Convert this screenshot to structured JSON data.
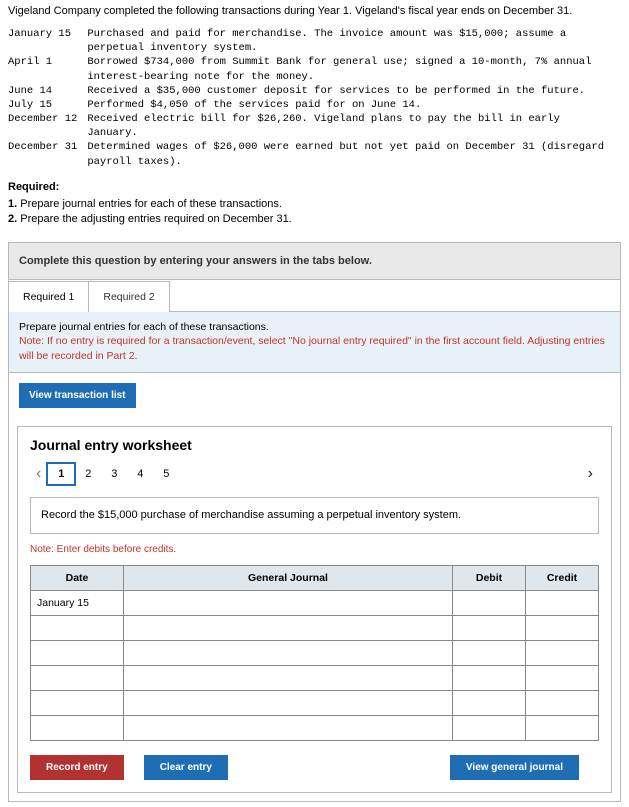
{
  "intro": "Vigeland Company completed the following transactions during Year 1. Vigeland's fiscal year ends on December 31.",
  "transactions": [
    {
      "date": "January 15",
      "desc": "Purchased and paid for merchandise. The invoice amount was $15,000; assume a perpetual inventory system."
    },
    {
      "date": "April 1",
      "desc": "Borrowed $734,000 from Summit Bank for general use; signed a 10-month, 7% annual interest-bearing note for the money."
    },
    {
      "date": "June 14",
      "desc": "Received a $35,000 customer deposit for services to be performed in the future."
    },
    {
      "date": "July 15",
      "desc": "Performed $4,050 of the services paid for on June 14."
    },
    {
      "date": "December 12",
      "desc": "Received electric bill for $26,260. Vigeland plans to pay the bill in early January."
    },
    {
      "date": "December 31",
      "desc": "Determined wages of $26,000 were earned but not yet paid on December 31 (disregard payroll taxes)."
    }
  ],
  "required_head": "Required:",
  "required_items": [
    {
      "num": "1.",
      "text": "Prepare journal entries for each of these transactions."
    },
    {
      "num": "2.",
      "text": "Prepare the adjusting entries required on December 31."
    }
  ],
  "banner": "Complete this question by entering your answers in the tabs below.",
  "tabs": [
    "Required 1",
    "Required 2"
  ],
  "tab_instruction_line1": "Prepare journal entries for each of these transactions.",
  "tab_instruction_line2": "Note: If no entry is required for a transaction/event, select \"No journal entry required\" in the first account field. Adjusting entries will be recorded in Part 2.",
  "view_tx_btn": "View transaction list",
  "worksheet": {
    "title": "Journal entry worksheet",
    "steps": [
      "1",
      "2",
      "3",
      "4",
      "5"
    ],
    "prompt": "Record the $15,000 purchase of merchandise assuming a perpetual inventory system.",
    "note": "Note: Enter debits before credits.",
    "columns": {
      "date": "Date",
      "journal": "General Journal",
      "debit": "Debit",
      "credit": "Credit"
    },
    "first_date": "January 15",
    "buttons": {
      "record": "Record entry",
      "clear": "Clear entry",
      "view": "View general journal"
    }
  }
}
